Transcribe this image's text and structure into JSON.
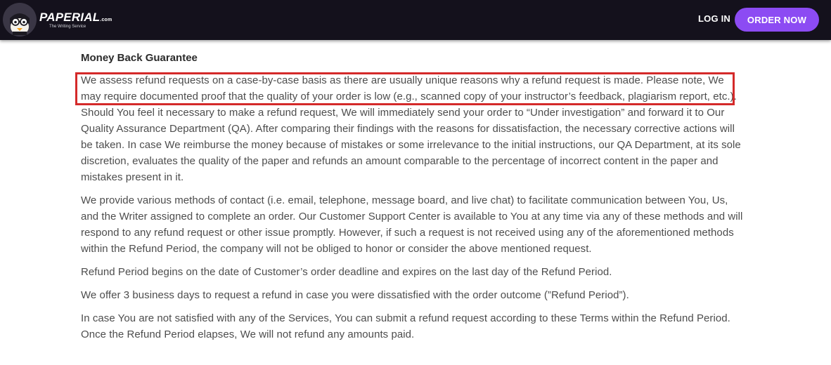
{
  "header": {
    "brand_name": "PAPERIAL",
    "brand_suffix": ".com",
    "brand_tagline": "The Writing Service",
    "login_label": "LOG IN",
    "order_label": "ORDER NOW",
    "colors": {
      "bar_bg": "#14111c",
      "order_button": "#8c4bf3",
      "highlight_border": "#d42a2a"
    }
  },
  "main": {
    "heading": "Money Back Guarantee",
    "paragraphs": [
      "We assess refund requests on a case-by-case basis as there are usually unique reasons why a refund request is made. Please note, We may require documented proof that the quality of your order is low (e.g., scanned copy of your instructor’s feedback, plagiarism report, etc.). Should You feel it necessary to make a refund request, We will immediately send your order to “Under investigation” and forward it to Our Quality Assurance Department (QA). After comparing their findings with the reasons for dissatisfaction, the necessary corrective actions will be taken. In case We reimburse the money because of mistakes or some irrelevance to the initial instructions, our QA Department, at its sole discretion, evaluates the quality of the paper and refunds an amount comparable to the percentage of incorrect content in the paper and mistakes present in it.",
      "We provide various methods of contact (i.e. email, telephone, message board, and live chat) to facilitate communication between You, Us, and the Writer assigned to complete an order. Our Customer Support Center is available to You at any time via any of these methods and will respond to any refund request or other issue promptly. However, if such a request is not received using any of the aforementioned methods within the Refund Period, the company will not be obliged to honor or consider the above mentioned request.",
      "Refund Period begins on the date of Customer’s order deadline and expires on the last day of the Refund Period.",
      "We offer 3 business days to request a refund in case you were dissatisfied with the order outcome (”Refund Period”).",
      "In case You are not satisfied with any of the Services, You can submit a refund request according to these Terms within the Refund Period. Once the Refund Period elapses, We will not refund any amounts paid."
    ]
  }
}
